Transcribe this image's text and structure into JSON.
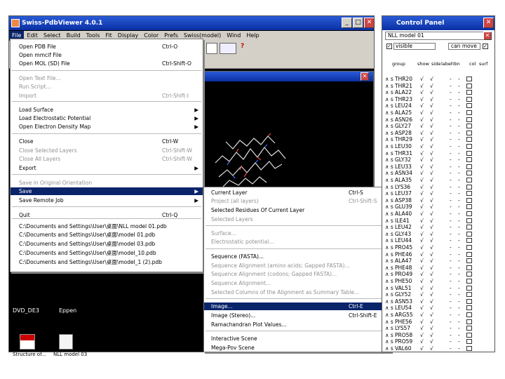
{
  "app": {
    "title": "Swiss-PdbViewer 4.0.1"
  },
  "menubar": [
    "File",
    "Edit",
    "Select",
    "Build",
    "Tools",
    "Fit",
    "Display",
    "Color",
    "Prefs",
    "Swiss(model)",
    "Wind",
    "Help"
  ],
  "file_menu": [
    {
      "label": "Open PDB File",
      "shortcut": "Ctrl-O"
    },
    {
      "label": "Open mmcif File",
      "shortcut": ""
    },
    {
      "label": "Open MOL (SD) File",
      "shortcut": "Ctrl-Shift-O"
    },
    {
      "label": "Open Text File...",
      "shortcut": ""
    },
    {
      "label": "Run Script...",
      "shortcut": ""
    },
    {
      "label": "Import",
      "shortcut": "Ctrl-Shift-I"
    },
    {
      "label": "Load Surface",
      "shortcut": ""
    },
    {
      "label": "Load Electrostatic Potential",
      "shortcut": ""
    },
    {
      "label": "Open Electron Density Map",
      "shortcut": ""
    },
    {
      "label": "Close",
      "shortcut": "Ctrl-W"
    },
    {
      "label": "Close Selected Layers",
      "shortcut": "Ctrl-Shift-W"
    },
    {
      "label": "Close All Layers",
      "shortcut": "Ctrl-Shift-W"
    },
    {
      "label": "Export",
      "shortcut": ""
    },
    {
      "label": "Save in Original Orientation",
      "shortcut": ""
    },
    {
      "label": "Save",
      "shortcut": ""
    },
    {
      "label": "Save Remote Job",
      "shortcut": ""
    },
    {
      "label": "Quit",
      "shortcut": "Ctrl-Q"
    },
    {
      "label": "C:\\Documents and Settings\\User\\桌面\\NLL model 01.pdb",
      "shortcut": ""
    },
    {
      "label": "C:\\Documents and Settings\\User\\桌面\\model 01.pdb",
      "shortcut": ""
    },
    {
      "label": "C:\\Documents and Settings\\User\\桌面\\model 03.pdb",
      "shortcut": ""
    },
    {
      "label": "C:\\Documents and Settings\\User\\桌面\\model_10.pdb",
      "shortcut": ""
    },
    {
      "label": "C:\\Documents and Settings\\User\\桌面\\model_1 (2).pdb",
      "shortcut": ""
    }
  ],
  "save_submenu": [
    {
      "label": "Current Layer",
      "shortcut": "Ctrl-S"
    },
    {
      "label": "Project (all layers)",
      "shortcut": "Ctrl-Shift-S"
    },
    {
      "label": "Selected Residues Of Current Layer",
      "shortcut": ""
    },
    {
      "label": "Selected Layers",
      "shortcut": ""
    },
    {
      "label": "Surface...",
      "shortcut": ""
    },
    {
      "label": "Electrostatic potential...",
      "shortcut": ""
    },
    {
      "label": "Sequence (FASTA)...",
      "shortcut": ""
    },
    {
      "label": "Sequence Alignment (amino acids; Gapped FASTA)...",
      "shortcut": ""
    },
    {
      "label": "Sequence Alignment (codons; Gapped FASTA)...",
      "shortcut": ""
    },
    {
      "label": "Sequence Alignment...",
      "shortcut": ""
    },
    {
      "label": "Selected Columns of the Alignment as Summary Table...",
      "shortcut": ""
    },
    {
      "label": "Image...",
      "shortcut": "Ctrl-E"
    },
    {
      "label": "Image (Stereo)...",
      "shortcut": "Ctrl-Shift-E"
    },
    {
      "label": "Ramachandran Plot Values...",
      "shortcut": ""
    },
    {
      "label": "Interactive Scene",
      "shortcut": ""
    },
    {
      "label": "Mega-Pov Scene",
      "shortcut": ""
    }
  ],
  "control_panel": {
    "title": "Control Panel",
    "layer": "NLL model 01",
    "visible_label": "visible",
    "can_move_label": "can move",
    "col_group": "group",
    "col_show": "show",
    "col_side": "side",
    "col_label": "label",
    "col_ribn": "ribn",
    "col_col": "col",
    "col_surf": "surf",
    "residues": [
      "THR20",
      "THR21",
      "ALA22",
      "THR23",
      "LEU24",
      "ALA25",
      "ASN26",
      "GLY27",
      "ASP28",
      "THR29",
      "LEU30",
      "THR31",
      "GLY32",
      "LEU33",
      "ASN34",
      "ALA35",
      "LYS36",
      "LEU37",
      "ASP38",
      "GLU39",
      "ALA40",
      "ILE41",
      "LEU42",
      "GLY43",
      "LEU44",
      "PRO45",
      "PHE46",
      "ALA47",
      "PHE48",
      "PRO49",
      "PHE50",
      "VAL51",
      "GLY52",
      "ASN53",
      "LEU54",
      "ARG55",
      "PHE56",
      "LYS57",
      "PRO58",
      "PRO59",
      "VAL60"
    ]
  },
  "desktop": {
    "icons": [
      "DVD_DE3",
      "Eppen",
      "Structure of...",
      "NLL model 03"
    ]
  }
}
